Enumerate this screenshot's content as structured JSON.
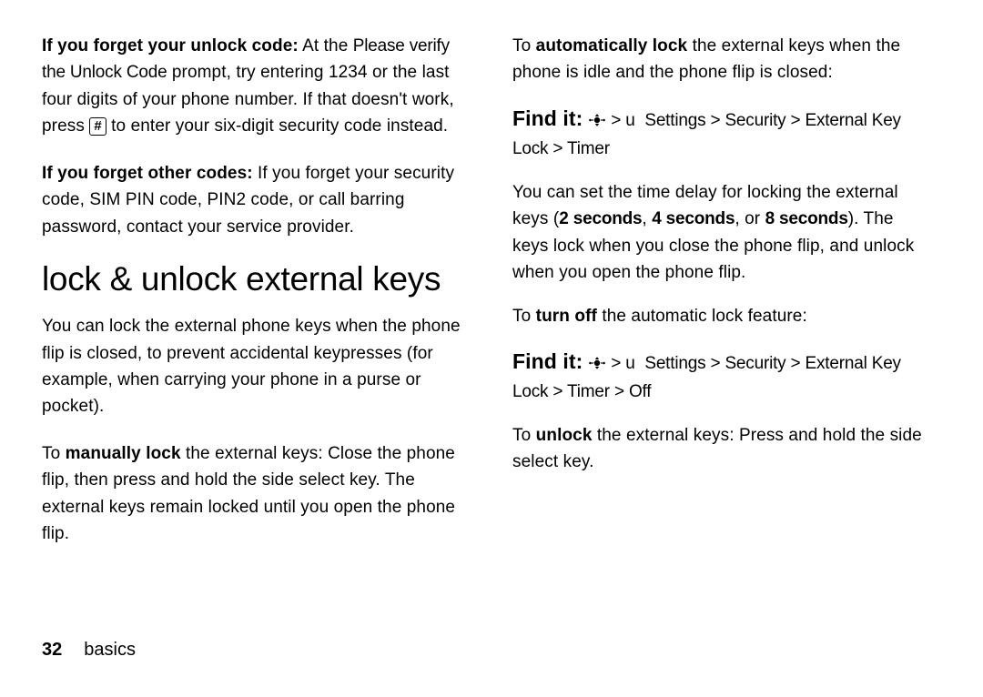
{
  "left": {
    "p1_lead": "If you forget your unlock code:",
    "p1_a": " At the ",
    "p1_prompt": "Please verify the Unlock Code",
    "p1_b": " prompt, try entering 1234 or the last four digits of your phone number. If that doesn't work, press ",
    "p1_hash": "#",
    "p1_c": " to enter your six-digit security code instead.",
    "p2_lead": "If you forget other codes:",
    "p2_body": " If you forget your security code, SIM PIN code, PIN2 code, or call barring password, contact your service provider.",
    "heading": "lock & unlock external keys",
    "p3": "You can lock the external phone keys when the phone flip is closed, to prevent accidental keypresses (for example, when carrying your phone in a purse or pocket).",
    "p4_a": "To ",
    "p4_bold": "manually lock",
    "p4_b": " the external keys: Close the phone flip, then press and hold the side select key. The external keys remain locked until you open the phone flip."
  },
  "right": {
    "p1_a": "To ",
    "p1_bold": "automatically lock",
    "p1_b": " the external keys when the phone is idle and the phone flip is closed:",
    "findit_label": "Find it:",
    "findit_u": "u",
    "findit1_path_a": "Settings > Security > External Key Lock > Timer",
    "p2_a": "You can set the time delay for locking the external keys (",
    "p2_opt1": "2 seconds",
    "p2_sep1": ", ",
    "p2_opt2": "4 seconds",
    "p2_sep2": ", or ",
    "p2_opt3": "8 seconds",
    "p2_b": "). The keys lock when you close the phone flip, and unlock when you open the phone flip.",
    "p3_a": "To ",
    "p3_bold": "turn off",
    "p3_b": " the automatic lock feature:",
    "findit2_path_a": "Settings > Security > External Key Lock > Timer > Off",
    "p4_a": "To ",
    "p4_bold": "unlock",
    "p4_b": " the external keys: Press and hold the side select key."
  },
  "footer": {
    "page": "32",
    "section": "basics"
  }
}
